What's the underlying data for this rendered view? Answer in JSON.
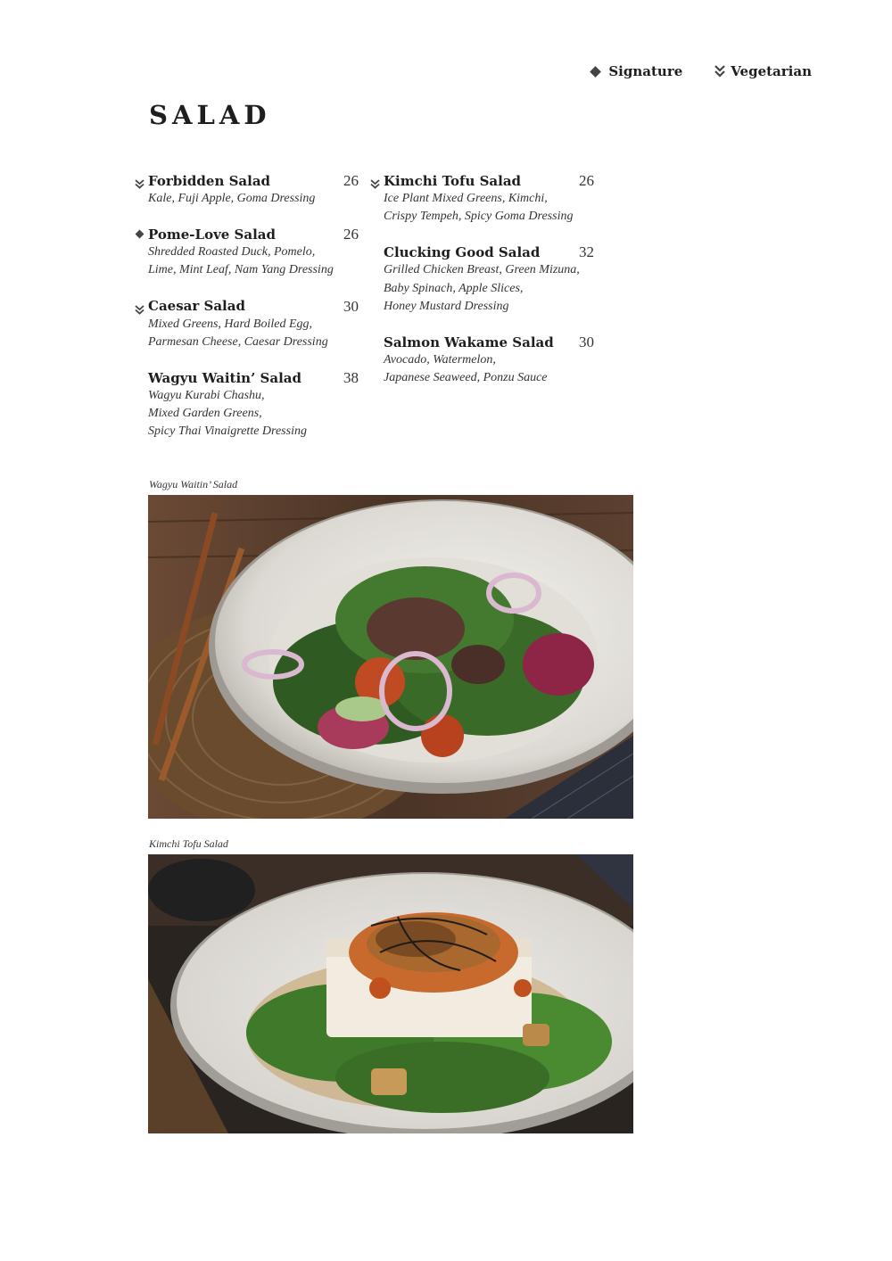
{
  "legend": {
    "signature_label": "Signature",
    "vegetarian_label": "Vegetarian",
    "signature_icon": "diamond-icon",
    "vegetarian_icon": "double-chevron-down-icon"
  },
  "section_title": "SALAD",
  "menu": {
    "left": [
      {
        "name": "Forbidden Salad",
        "price": "26",
        "marker": "vegetarian",
        "desc": [
          "Kale, Fuji Apple, Goma Dressing"
        ]
      },
      {
        "name": "Pome-Love Salad",
        "price": "26",
        "marker": "signature",
        "desc": [
          "Shredded Roasted Duck, Pomelo,",
          "Lime, Mint Leaf, Nam Yang Dressing"
        ]
      },
      {
        "name": "Caesar Salad",
        "price": "30",
        "marker": "vegetarian",
        "desc": [
          "Mixed Greens, Hard Boiled Egg,",
          "Parmesan Cheese, Caesar Dressing"
        ]
      },
      {
        "name": "Wagyu Waitin’ Salad",
        "price": "38",
        "marker": "",
        "desc": [
          "Wagyu Kurabi Chashu,",
          "Mixed Garden Greens,",
          "Spicy Thai Vinaigrette Dressing"
        ]
      }
    ],
    "right": [
      {
        "name": "Kimchi Tofu Salad",
        "price": "26",
        "marker": "vegetarian",
        "desc": [
          "Ice Plant Mixed Greens, Kimchi,",
          "Crispy Tempeh, Spicy Goma Dressing"
        ]
      },
      {
        "name": "Clucking Good Salad",
        "price": "32",
        "marker": "",
        "desc": [
          "Grilled Chicken Breast, Green Mizuna,",
          "Baby Spinach, Apple Slices,",
          "Honey Mustard Dressing"
        ]
      },
      {
        "name": "Salmon Wakame Salad",
        "price": "30",
        "marker": "",
        "desc": [
          "Avocado, Watermelon,",
          "Japanese Seaweed, Ponzu Sauce"
        ]
      }
    ]
  },
  "photos": [
    {
      "caption": "Wagyu Waitin’ Salad"
    },
    {
      "caption": "Kimchi Tofu Salad"
    }
  ],
  "colors": {
    "text": "#1e1e1e",
    "wood": "#5a4030",
    "plate": "#e8e6e2",
    "greens": "#3e6b2c"
  }
}
